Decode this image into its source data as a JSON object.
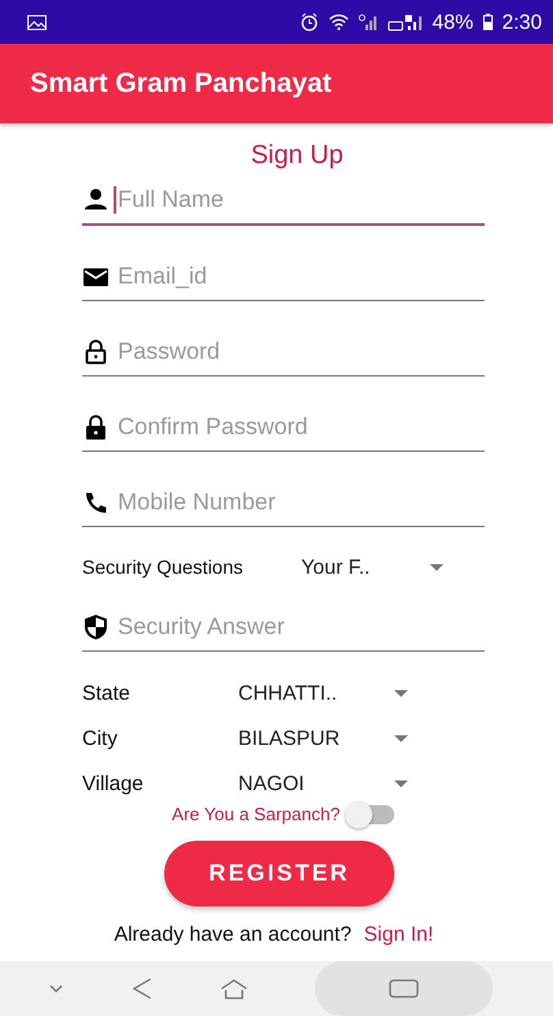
{
  "status_bar": {
    "battery": "48%",
    "time": "2:30"
  },
  "app_bar": {
    "title": "Smart Gram Panchayat"
  },
  "form": {
    "heading": "Sign Up",
    "fields": [
      {
        "placeholder": "Full Name",
        "focused": true
      },
      {
        "placeholder": "Email_id",
        "focused": false
      },
      {
        "placeholder": "Password",
        "focused": false
      },
      {
        "placeholder": "Confirm Password",
        "focused": false
      },
      {
        "placeholder": "Mobile Number",
        "focused": false
      }
    ],
    "security_question": {
      "label": "Security Questions",
      "value": "Your F.."
    },
    "security_answer": {
      "placeholder": "Security Answer",
      "focused": false
    },
    "locations": [
      {
        "label": "State",
        "value": "CHHATTI.."
      },
      {
        "label": "City",
        "value": "BILASPUR"
      },
      {
        "label": "Village",
        "value": "NAGOI"
      }
    ],
    "sarpanch": {
      "label": "Are You a Sarpanch?",
      "on": false
    },
    "register_button": "REGISTER",
    "footer": {
      "text": "Already have an account?",
      "link": "Sign In!"
    }
  }
}
